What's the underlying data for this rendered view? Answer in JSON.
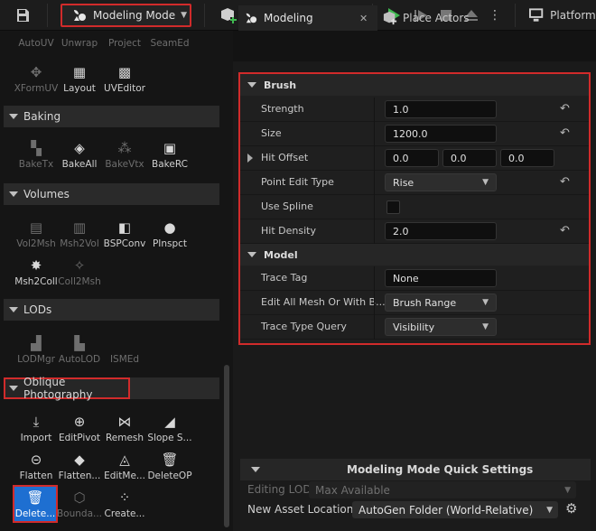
{
  "toolbar": {
    "mode_label": "Modeling Mode",
    "platforms_label": "Platforms"
  },
  "palette": {
    "top_tools": [
      {
        "label": "AutoUV",
        "dim": true
      },
      {
        "label": "Unwrap",
        "dim": true
      },
      {
        "label": "Project",
        "dim": true
      },
      {
        "label": "SeamEd",
        "dim": true
      },
      {
        "label": "XFormUV",
        "dim": true
      },
      {
        "label": "Layout",
        "dim": false
      },
      {
        "label": "UVEditor",
        "dim": false
      }
    ],
    "sections": {
      "baking": {
        "title": "Baking",
        "tools": [
          {
            "label": "BakeTx",
            "dim": true
          },
          {
            "label": "BakeAll",
            "dim": false
          },
          {
            "label": "BakeVtx",
            "dim": true
          },
          {
            "label": "BakeRC",
            "dim": false
          }
        ]
      },
      "volumes": {
        "title": "Volumes",
        "tools": [
          {
            "label": "Vol2Msh",
            "dim": true
          },
          {
            "label": "Msh2Vol",
            "dim": true
          },
          {
            "label": "BSPConv",
            "dim": false
          },
          {
            "label": "PInspct",
            "dim": false
          },
          {
            "label": "Msh2Coll",
            "dim": false
          },
          {
            "label": "Coll2Msh",
            "dim": true
          }
        ]
      },
      "lods": {
        "title": "LODs",
        "tools": [
          {
            "label": "LODMgr",
            "dim": true
          },
          {
            "label": "AutoLOD",
            "dim": true
          },
          {
            "label": "ISMEd",
            "dim": true
          }
        ]
      },
      "oblique": {
        "title": "Oblique Photography",
        "tools": [
          {
            "label": "Import",
            "dim": false
          },
          {
            "label": "EditPivot",
            "dim": false
          },
          {
            "label": "Remesh",
            "dim": false
          },
          {
            "label": "Slope S...",
            "dim": false
          },
          {
            "label": "Flatten",
            "dim": false
          },
          {
            "label": "Flatten...",
            "dim": false
          },
          {
            "label": "EditMe...",
            "dim": false
          },
          {
            "label": "DeleteOP",
            "dim": false
          },
          {
            "label": "Delete...",
            "dim": false
          },
          {
            "label": "Bounda...",
            "dim": true
          },
          {
            "label": "Create...",
            "dim": false
          }
        ]
      }
    }
  },
  "tabs": {
    "modeling": "Modeling",
    "close_glyph": "✕",
    "place_actors": "Place Actors"
  },
  "details": {
    "brush": {
      "title": "Brush",
      "strength": {
        "label": "Strength",
        "value": "1.0"
      },
      "size": {
        "label": "Size",
        "value": "1200.0"
      },
      "hit_offset": {
        "label": "Hit Offset",
        "x": "0.0",
        "y": "0.0",
        "z": "0.0"
      },
      "point_edit_type": {
        "label": "Point Edit Type",
        "value": "Rise"
      },
      "use_spline": {
        "label": "Use Spline"
      },
      "hit_density": {
        "label": "Hit Density",
        "value": "2.0"
      }
    },
    "model": {
      "title": "Model",
      "trace_tag": {
        "label": "Trace Tag",
        "value": "None"
      },
      "edit_all_mesh": {
        "label": "Edit All Mesh Or With B...",
        "value": "Brush Range"
      },
      "trace_type_query": {
        "label": "Trace Type Query",
        "value": "Visibility"
      }
    }
  },
  "quick_settings": {
    "title": "Modeling Mode Quick Settings",
    "editing_lod": {
      "label": "Editing LOD",
      "value": "Max Available"
    },
    "new_asset_location": {
      "label": "New Asset Location",
      "value": "AutoGen Folder (World-Relative)"
    }
  },
  "colors": {
    "highlight_red": "#d12b2b",
    "selected_blue": "#1e6fd1",
    "play_green": "#3fb950"
  }
}
